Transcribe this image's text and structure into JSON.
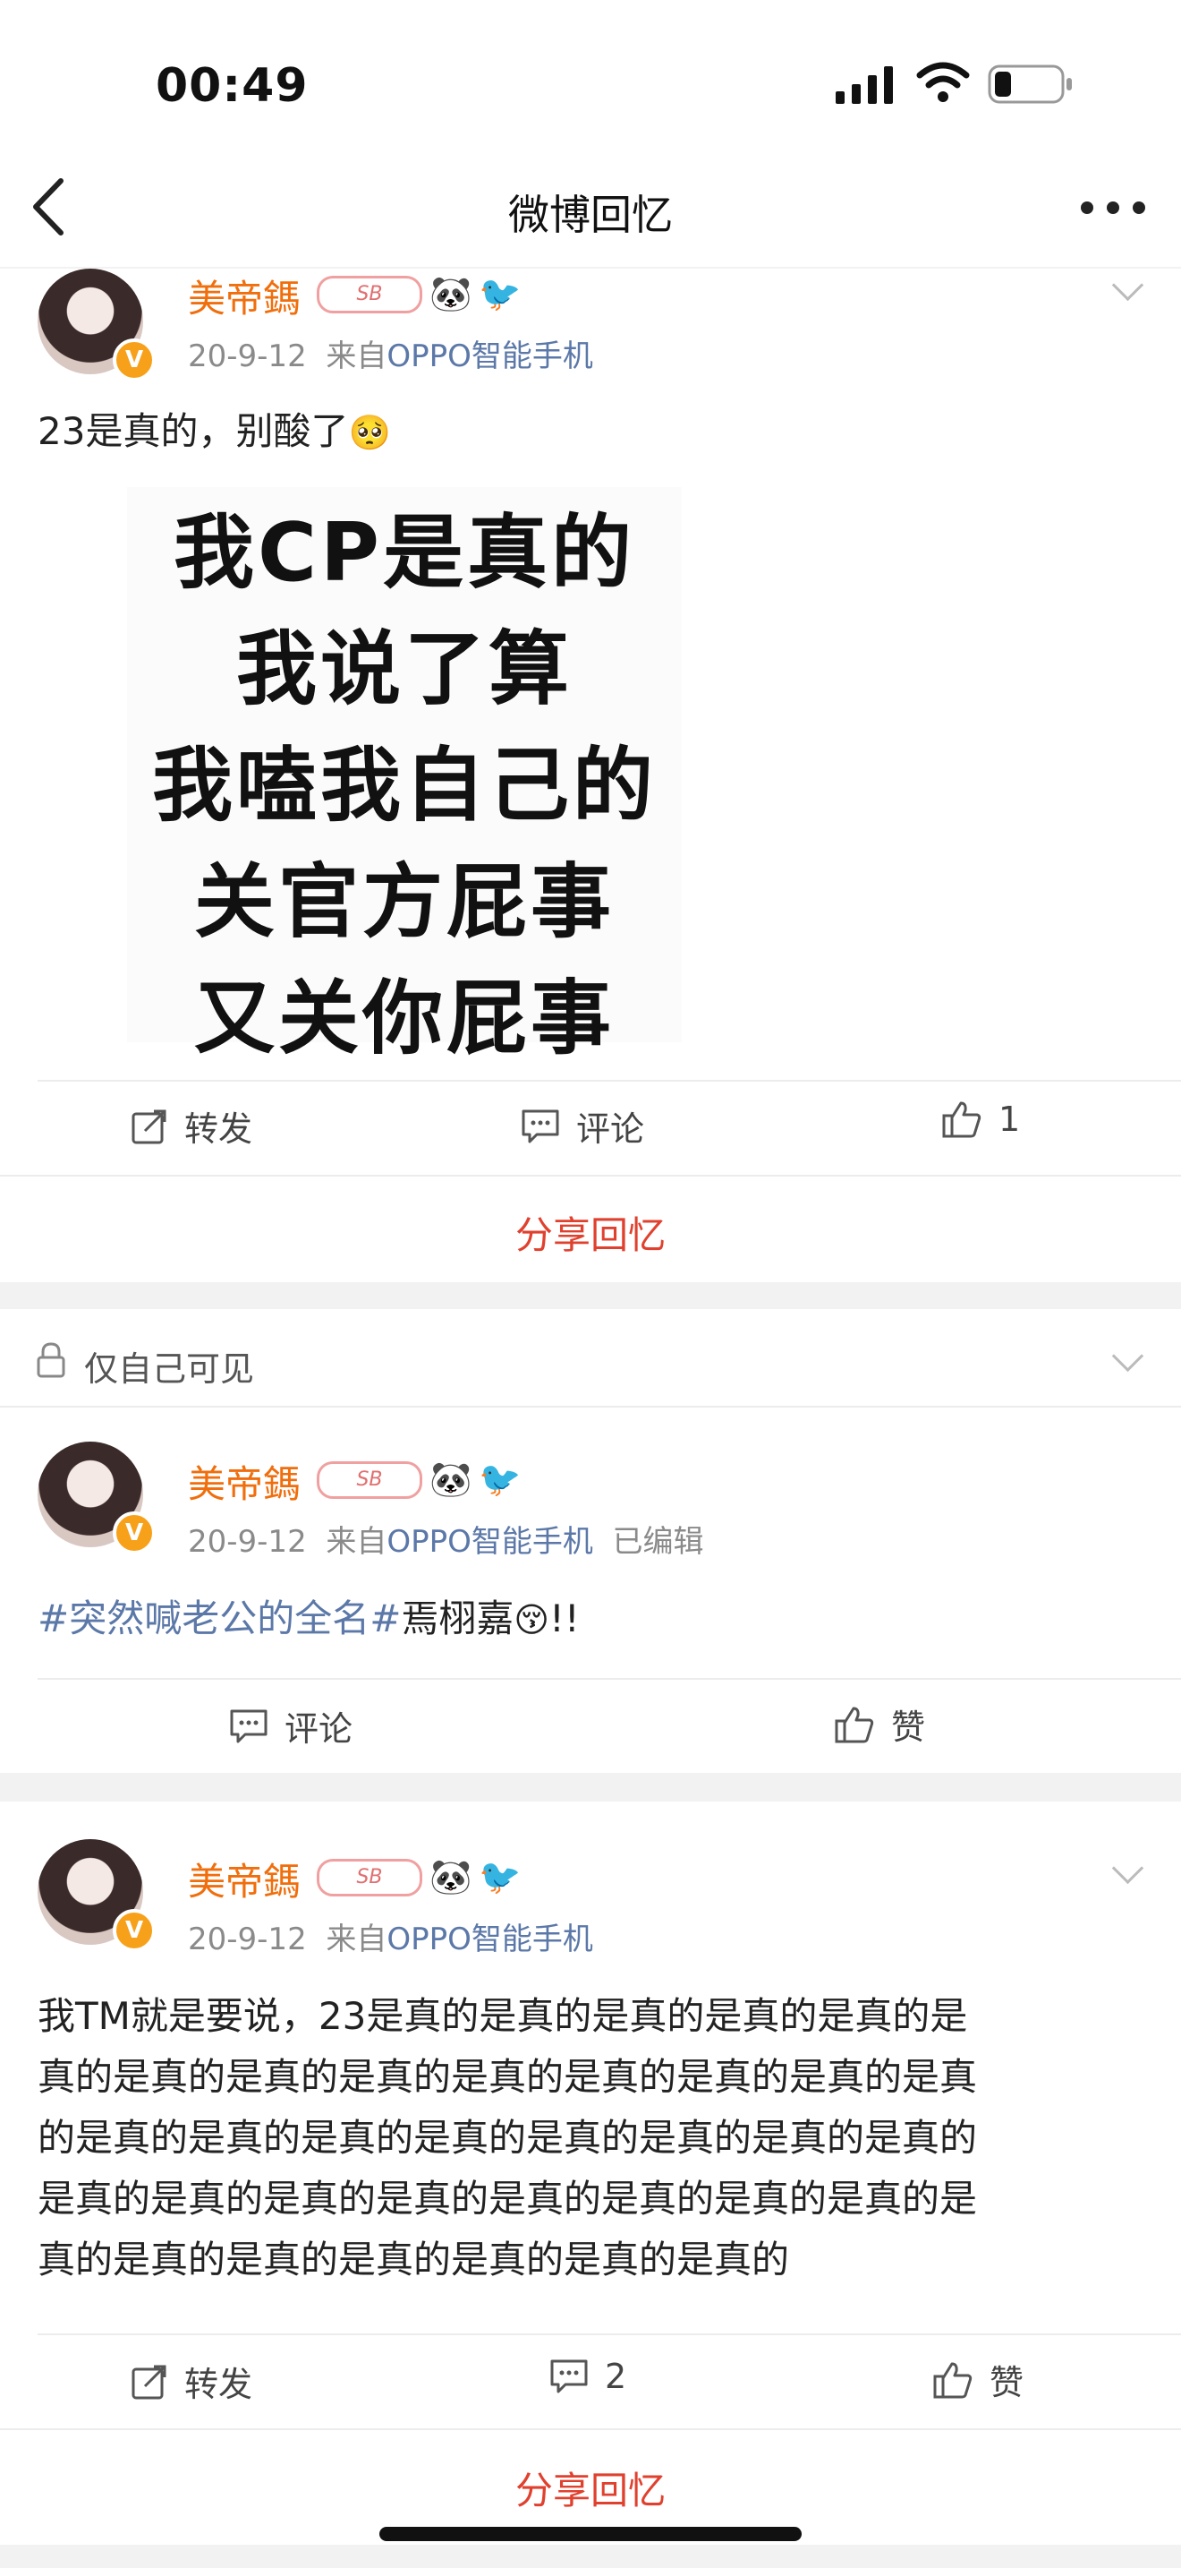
{
  "status_bar": {
    "time": "00:49"
  },
  "nav": {
    "title": "微博回忆"
  },
  "post1": {
    "username": "美帝鎷",
    "badge_text": "SB",
    "date": "20-9-12",
    "source_prefix": "来自",
    "source": "OPPO智能手机",
    "text": "23是真的，别酸了",
    "meme_lines": [
      "我CP是真的",
      "我说了算",
      "我嗑我自己的",
      "关官方屁事",
      "又关你屁事"
    ],
    "repost_label": "转发",
    "comment_label": "评论",
    "like_count": "1",
    "share_label": "分享回忆"
  },
  "post2": {
    "privacy_label": "仅自己可见",
    "username": "美帝鎷",
    "badge_text": "SB",
    "date": "20-9-12",
    "source_prefix": "来自",
    "source": "OPPO智能手机",
    "edited": "已编辑",
    "topic": "#突然喊老公的全名#",
    "text": "焉栩嘉",
    "text_suffix": "!!",
    "comment_label": "评论",
    "like_label": "赞"
  },
  "post3": {
    "username": "美帝鎷",
    "badge_text": "SB",
    "date": "20-9-12",
    "source_prefix": "来自",
    "source": "OPPO智能手机",
    "text_lines": [
      "我TM就是要说，23是真的是真的是真的是真的是真的是",
      "真的是真的是真的是真的是真的是真的是真的是真的是真",
      "的是真的是真的是真的是真的是真的是真的是真的是真的",
      "是真的是真的是真的是真的是真的是真的是真的是真的是",
      "真的是真的是真的是真的是真的是真的是真的"
    ],
    "repost_label": "转发",
    "comment_count": "2",
    "like_label": "赞",
    "share_label": "分享回忆"
  },
  "colors": {
    "username": "#f06e0c",
    "link": "#5b78a8",
    "share": "#e0412f",
    "background": "#f2f2f2"
  }
}
